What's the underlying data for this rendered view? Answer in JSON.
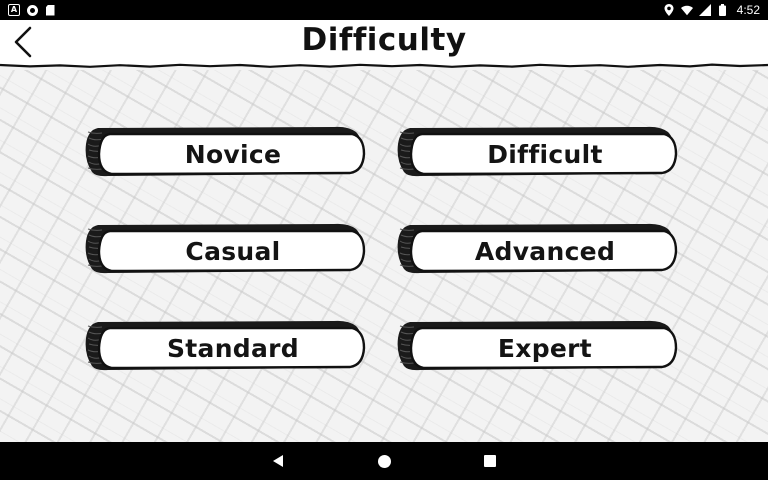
{
  "status_bar": {
    "time": "4:52",
    "left_icons": [
      "notification-a-icon",
      "sync-circle-icon",
      "sd-card-icon"
    ],
    "right_icons": [
      "location-icon",
      "wifi-icon",
      "signal-icon",
      "battery-icon"
    ]
  },
  "header": {
    "title": "Difficulty",
    "back_icon": "chevron-left-icon"
  },
  "difficulty_options": [
    {
      "id": "novice",
      "label": "Novice"
    },
    {
      "id": "difficult",
      "label": "Difficult"
    },
    {
      "id": "casual",
      "label": "Casual"
    },
    {
      "id": "advanced",
      "label": "Advanced"
    },
    {
      "id": "standard",
      "label": "Standard"
    },
    {
      "id": "expert",
      "label": "Expert"
    }
  ],
  "nav_bar": {
    "icons": [
      "back-triangle-icon",
      "home-circle-icon",
      "recents-square-icon"
    ]
  },
  "colors": {
    "status_bar": "#000000",
    "header_bg": "#ffffff",
    "button_fill": "#ffffff",
    "button_ink": "#141414",
    "background": "#f3f3f3"
  }
}
